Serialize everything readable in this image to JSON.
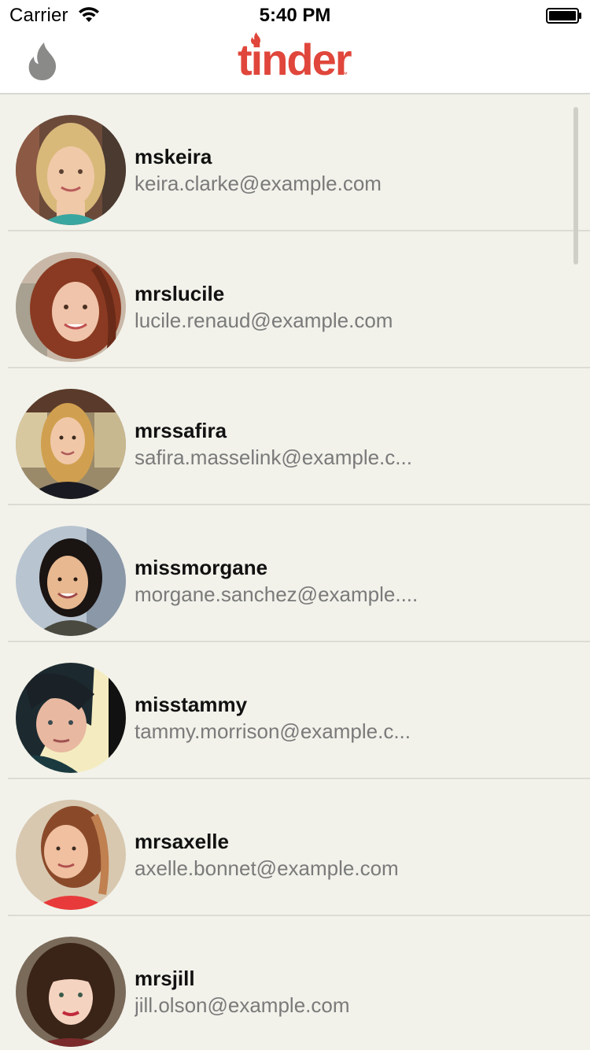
{
  "status_bar": {
    "carrier": "Carrier",
    "time": "5:40 PM"
  },
  "nav": {
    "logo_text": "tinder",
    "logo_tm": "™",
    "left_icon": "flame-icon"
  },
  "colors": {
    "brand": "#e0463b",
    "background": "#f2f2eb",
    "text_primary": "#111111",
    "text_secondary": "#7a7a7a"
  },
  "users": [
    {
      "username": "mskeira",
      "email": "keira.clarke@example.com"
    },
    {
      "username": "mrslucile",
      "email": "lucile.renaud@example.com"
    },
    {
      "username": "mrssafira",
      "email": "safira.masselink@example.c..."
    },
    {
      "username": "missmorgane",
      "email": "morgane.sanchez@example...."
    },
    {
      "username": "misstammy",
      "email": "tammy.morrison@example.c..."
    },
    {
      "username": "mrsaxelle",
      "email": "axelle.bonnet@example.com"
    },
    {
      "username": "mrsjill",
      "email": "jill.olson@example.com"
    }
  ]
}
